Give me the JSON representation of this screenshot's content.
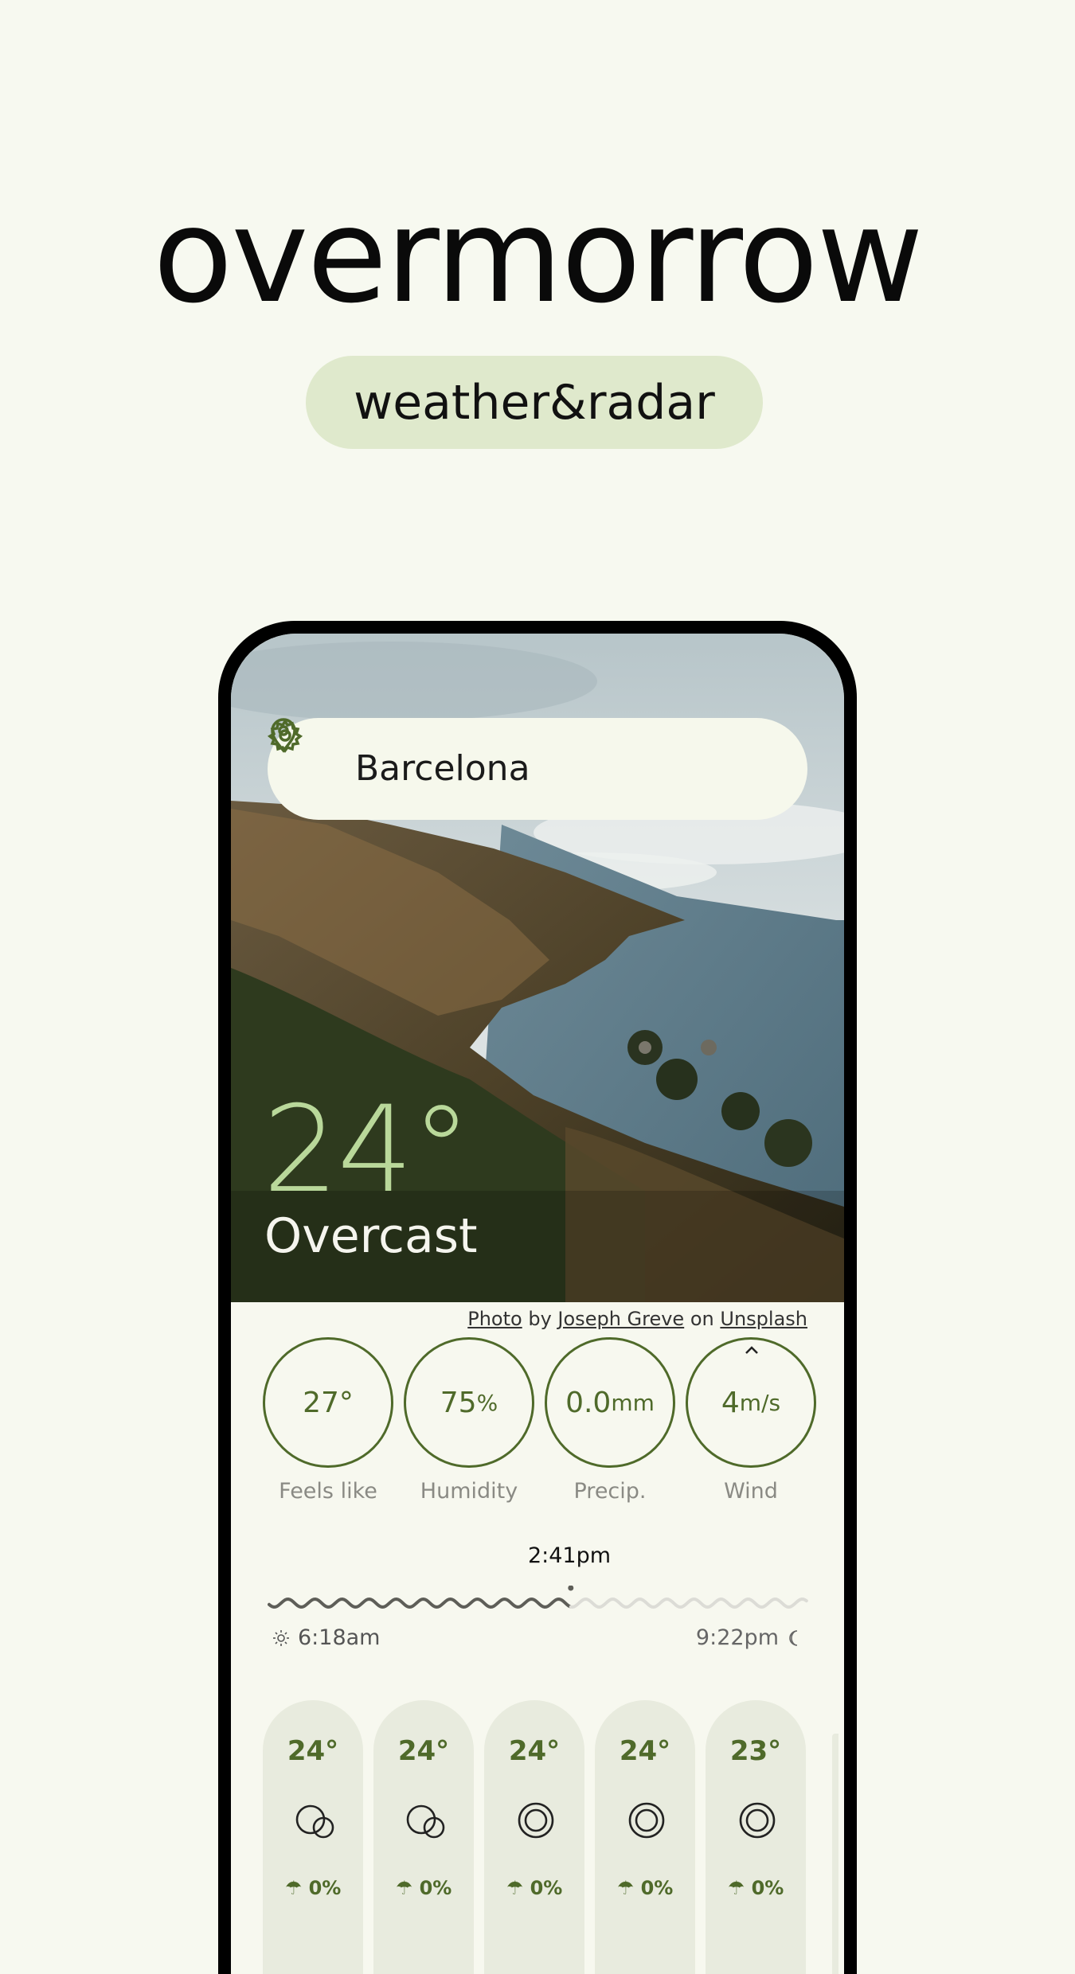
{
  "brand": {
    "title": "overmorrow",
    "tagline": "weather&radar"
  },
  "location": {
    "city": "Barcelona"
  },
  "current": {
    "temperature": "24°",
    "condition": "Overcast"
  },
  "credit": {
    "photo": "Photo",
    "by": "by",
    "author": "Joseph Greve",
    "on": "on",
    "source": "Unsplash"
  },
  "stats": [
    {
      "value": "27°",
      "unit": "",
      "label": "Feels like"
    },
    {
      "value": "75",
      "unit": "%",
      "label": "Humidity"
    },
    {
      "value": "0.0",
      "unit": "mm",
      "label": "Precip."
    },
    {
      "value": "4",
      "unit": "m/s",
      "label": "Wind"
    }
  ],
  "sun": {
    "now": "2:41pm",
    "sunrise": "6:18am",
    "sunset": "9:22pm",
    "day_progress": 0.56
  },
  "hourly": [
    {
      "temp": "24°",
      "icon": "partly-cloudy-icon",
      "precip": "0%"
    },
    {
      "temp": "24°",
      "icon": "partly-cloudy-icon",
      "precip": "0%"
    },
    {
      "temp": "24°",
      "icon": "clear-icon",
      "precip": "0%"
    },
    {
      "temp": "24°",
      "icon": "clear-icon",
      "precip": "0%"
    },
    {
      "temp": "23°",
      "icon": "clear-icon",
      "precip": "0%"
    }
  ],
  "colors": {
    "accent": "#4f6a2a",
    "temp_highlight": "#b9d89a",
    "pill": "#dfe9cc",
    "background": "#f7f9f0"
  }
}
